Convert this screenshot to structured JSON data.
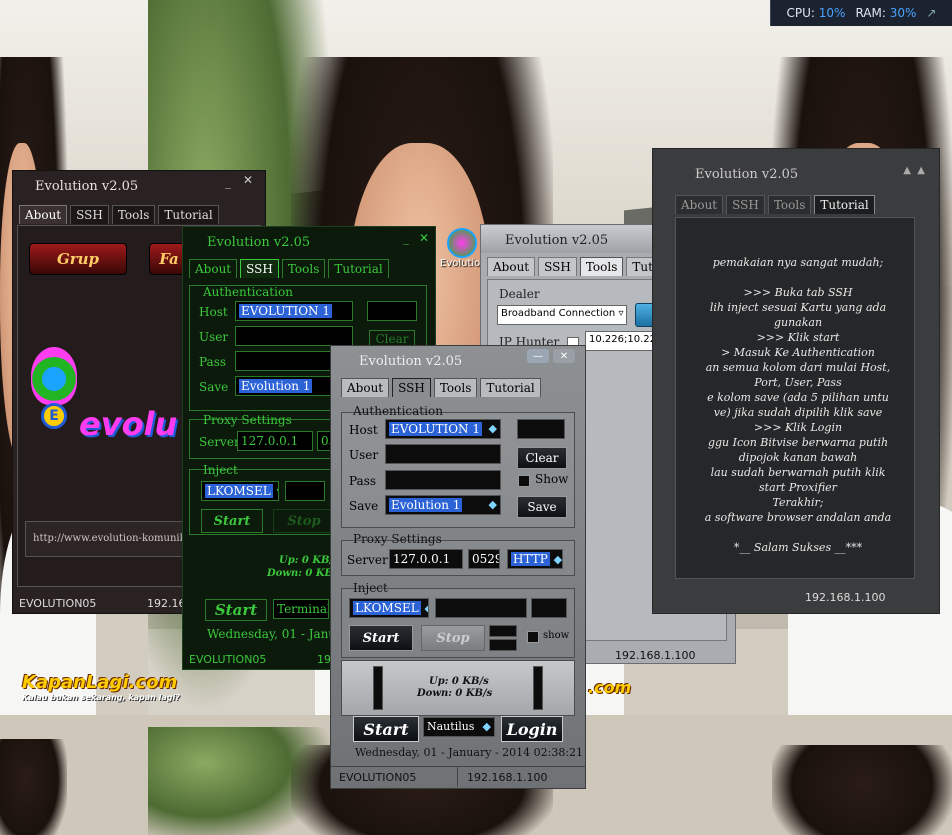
{
  "system_monitor": {
    "cpu_label": "CPU:",
    "cpu_value": "10%",
    "ram_label": "RAM:",
    "ram_value": "30%"
  },
  "wallpaper": {
    "watermark": "KapanLagi.com",
    "watermark_tagline": "Kalau bukan sekarang, kapan lagi?"
  },
  "desktop_icon": {
    "label": "Evolution"
  },
  "win_about": {
    "title": "Evolution v2.05",
    "tabs": [
      "About",
      "SSH",
      "Tools",
      "Tutorial"
    ],
    "grup_button": "Grup",
    "fa_button": "Fa",
    "logo_text": "evolu",
    "url": "http://www.evolution-komunika",
    "status_left": "EVOLUTION05",
    "status_right": "192.168"
  },
  "win_green": {
    "title": "Evolution v2.05",
    "tabs": [
      "About",
      "SSH",
      "Tools",
      "Tutorial"
    ],
    "auth_title": "Authentication",
    "host_label": "Host",
    "host_value": "EVOLUTION 1",
    "user_label": "User",
    "pass_label": "Pass",
    "clear_button": "Clear",
    "save_label": "Save",
    "save_value": "Evolution 1",
    "proxy_title": "Proxy Settings",
    "server_label": "Server",
    "server_value": "127.0.0.1",
    "port_value": "05",
    "inject_title": "Inject",
    "inject_value": "LKOMSEL",
    "start_button": "Start",
    "stop_button": "Stop",
    "up_text": "Up: 0 KB/s",
    "down_text": "Down: 0 KB/s",
    "start_big": "Start",
    "terminal_value": "Terminal4(",
    "date": "Wednesday, 01 - January",
    "status_left": "EVOLUTION05",
    "status_right": "19"
  },
  "win_tools": {
    "title": "Evolution v2.05",
    "tabs": [
      "About",
      "SSH",
      "Tools",
      "Tutorial"
    ],
    "dealer_label": "Dealer",
    "dealer_value": "Broadband Connection",
    "dial_button": "Dial",
    "ip_hunter_label": "IP Hunter",
    "ip_value": "10.226;10.227;10.228;",
    "status_right": "192.168.1.100"
  },
  "win_tutorial": {
    "title": "Evolution v2.05",
    "tabs": [
      "About",
      "SSH",
      "Tools",
      "Tutorial"
    ],
    "lines": [
      "pemakaian nya sangat mudah;",
      "",
      ">>> Buka tab SSH",
      "lih inject sesuai Kartu yang ada",
      "gunakan",
      ">>> Klik start",
      "> Masuk Ke Authentication",
      "an semua kolom dari mulai Host,",
      "Port, User, Pass",
      "e kolom save (ada 5 pilihan untu",
      "ve) jika sudah dipilih klik save",
      ">>> Klik Login",
      "ggu Icon Bitvise berwarna putih",
      "dipojok kanan bawah",
      "lau sudah berwarnah putih klik",
      "start Proxifier",
      "Terakhir;",
      "a software browser andalan anda",
      "",
      "*__ Salam Sukses __***"
    ],
    "status_right": "192.168.1.100"
  },
  "win_main": {
    "title": "Evolution v2.05",
    "tabs": [
      "About",
      "SSH",
      "Tools",
      "Tutorial"
    ],
    "auth_title": "Authentication",
    "host_label": "Host",
    "host_value": "EVOLUTION 1",
    "user_label": "User",
    "pass_label": "Pass",
    "clear_button": "Clear",
    "show_label": "Show",
    "save_label": "Save",
    "save_value": "Evolution 1",
    "save_button": "Save",
    "proxy_title": "Proxy Settings",
    "server_label": "Server",
    "server_value": "127.0.0.1",
    "port_value": "0529",
    "proxy_type": "HTTP",
    "inject_title": "Inject",
    "inject_value": "LKOMSEL",
    "start_button": "Start",
    "stop_button": "Stop",
    "show_small": "show",
    "up_text": "Up: 0 KB/s",
    "down_text": "Down: 0 KB/s",
    "start_big": "Start",
    "client_value": "Nautilus",
    "login_button": "Login",
    "date": "Wednesday, 01 - January - 2014  02:38:21",
    "status_left": "EVOLUTION05",
    "status_right": "192.168.1.100"
  },
  "colors": {
    "accent_blue": "#2b62d6",
    "green_theme": "#3cc83c",
    "dial_button": "#2c8fc8"
  }
}
